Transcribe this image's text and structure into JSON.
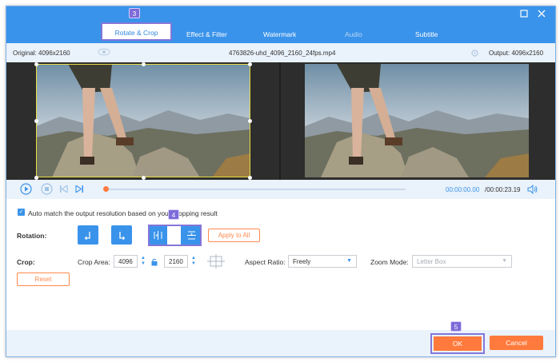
{
  "window": {
    "minimize_icon": "minimize-icon",
    "close_icon": "close-icon"
  },
  "tabs": [
    {
      "label": "Rotate & Crop",
      "active": true
    },
    {
      "label": "Effect & Filter",
      "active": false
    },
    {
      "label": "Watermark",
      "active": false
    },
    {
      "label": "Audio",
      "active": false
    },
    {
      "label": "Subtitle",
      "active": false
    }
  ],
  "step_markers": {
    "rotate_crop": "3",
    "flip": "4",
    "ok": "5"
  },
  "info": {
    "original": "Original: 4096x2160",
    "filename": "4763826-uhd_4096_2160_24fps.mp4",
    "output": "Output: 4096x2160"
  },
  "playback": {
    "current_time": "00:00:00.00",
    "total_time": "/00:00:23.19",
    "progress": 0.0
  },
  "auto_match": {
    "checked": true,
    "label": "Auto match the output resolution based on your cropping result"
  },
  "rotation": {
    "label": "Rotation:",
    "apply_all": "Apply to All"
  },
  "crop": {
    "label": "Crop:",
    "area_label": "Crop Area:",
    "width": "4096",
    "height": "2160",
    "aspect_label": "Aspect Ratio:",
    "aspect_value": "Freely",
    "zoom_label": "Zoom Mode:",
    "zoom_value": "Letter Box",
    "reset": "Reset"
  },
  "footer": {
    "ok": "OK",
    "cancel": "Cancel"
  },
  "colors": {
    "accent": "#3a93ea",
    "action": "#ff7a3c",
    "highlight": "#8476d9"
  }
}
